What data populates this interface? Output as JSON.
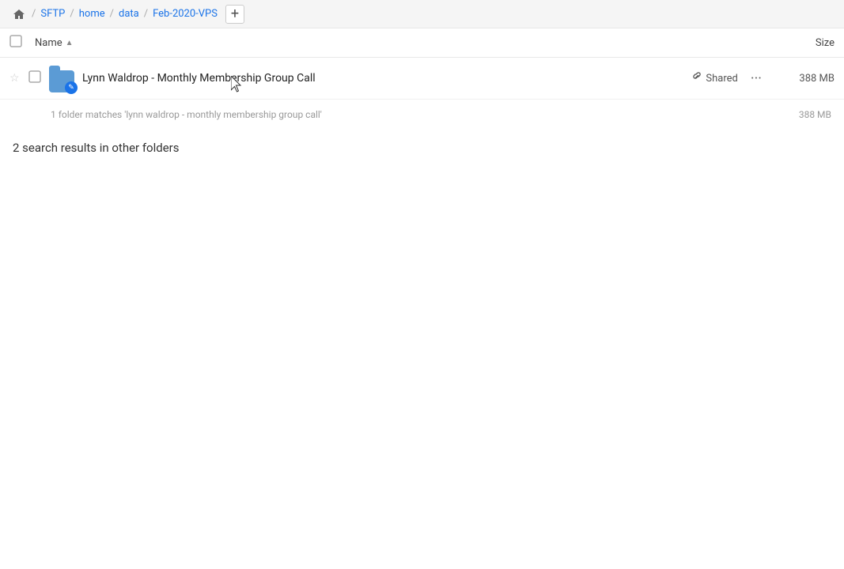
{
  "nav": {
    "home_icon": "⌂",
    "breadcrumbs": [
      "SFTP",
      "home",
      "data",
      "Feb-2020-VPS"
    ],
    "add_btn": "+"
  },
  "column_headers": {
    "checkbox_label": "",
    "name_label": "Name",
    "name_sort": "▲",
    "size_label": "Size"
  },
  "file_row": {
    "name": "Lynn Waldrop - Monthly Membership Group Call",
    "shared_label": "Shared",
    "size": "388 MB",
    "more_icon": "···"
  },
  "search_info": {
    "text": "1 folder matches 'lynn waldrop - monthly membership group call'",
    "size": "388 MB"
  },
  "other_folders": {
    "title": "2 search results in other folders"
  }
}
